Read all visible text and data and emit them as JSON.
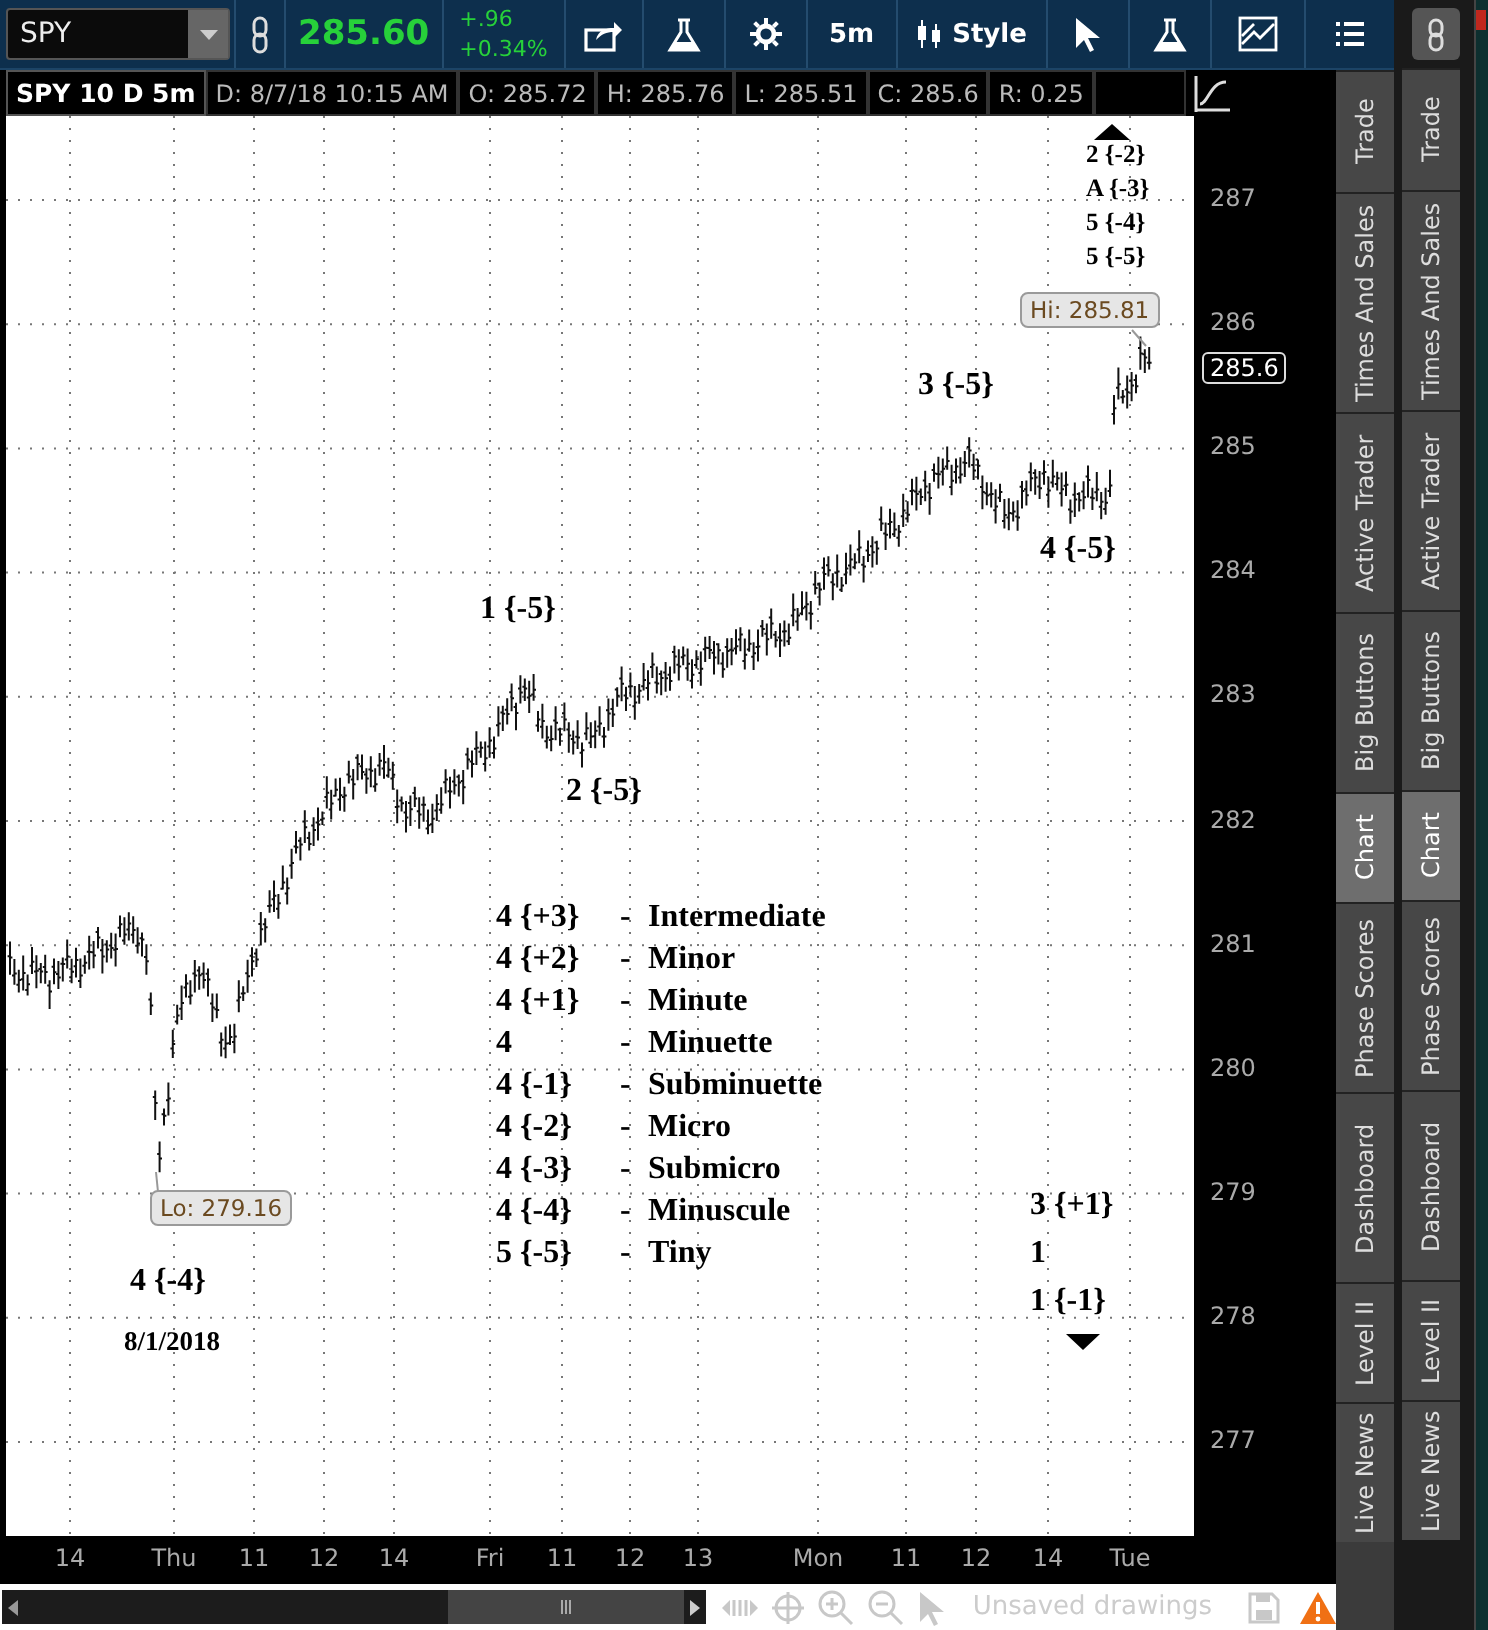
{
  "toolbar": {
    "symbol": "SPY",
    "last_price": "285.60",
    "change": "+.96",
    "change_percent": "+0.34%",
    "interval": "5m",
    "style_label": "Style"
  },
  "info_bar": {
    "title": "SPY 10 D 5m",
    "fields": [
      "D: 8/7/18 10:15 AM",
      "O: 285.72",
      "H: 285.76",
      "L: 285.51",
      "C: 285.6",
      "R: 0.25"
    ]
  },
  "chart": {
    "y_axis_labels": [
      "287",
      "286",
      "285",
      "284",
      "283",
      "282",
      "281",
      "280",
      "279",
      "278",
      "277"
    ],
    "last_price_label": "285.6",
    "x_axis_labels": [
      "14",
      "Thu",
      "11",
      "12",
      "14",
      "Fri",
      "11",
      "12",
      "13",
      "Mon",
      "11",
      "12",
      "14",
      "Tue"
    ],
    "annotations": [
      "1 {-5}",
      "2 {-5}",
      "3 {-5}",
      "4 {-5}",
      "2 {-2}",
      "A {-3}",
      "5 {-4}",
      "5 {-5}",
      "3 {+1}",
      "1",
      "1 {-1}",
      "4 {-4}",
      "8/1/2018"
    ],
    "legend": [
      {
        "wave": "4 {+3}",
        "separator": "-",
        "degree": "Intermediate"
      },
      {
        "wave": "4 {+2}",
        "separator": "-",
        "degree": "Minor"
      },
      {
        "wave": "4 {+1}",
        "separator": "-",
        "degree": "Minute"
      },
      {
        "wave": "4",
        "separator": "-",
        "degree": "Minuette"
      },
      {
        "wave": "4 {-1}",
        "separator": "-",
        "degree": "Subminuette"
      },
      {
        "wave": "4 {-2}",
        "separator": "-",
        "degree": "Micro"
      },
      {
        "wave": "4 {-3}",
        "separator": "-",
        "degree": "Submicro"
      },
      {
        "wave": "4 {-4}",
        "separator": "-",
        "degree": "Minuscule"
      },
      {
        "wave": "5 {-5}",
        "separator": "-",
        "degree": "Tiny"
      }
    ],
    "high_callout": "Hi: 285.81",
    "low_callout": "Lo: 279.16"
  },
  "drawing_bar": {
    "status": "Unsaved drawings"
  },
  "side_tabs": [
    {
      "label": "Trade",
      "selected": false
    },
    {
      "label": "Times And Sales",
      "selected": false
    },
    {
      "label": "Active Trader",
      "selected": false
    },
    {
      "label": "Big Buttons",
      "selected": false
    },
    {
      "label": "Chart",
      "selected": true
    },
    {
      "label": "Phase Scores",
      "selected": false
    },
    {
      "label": "Dashboard",
      "selected": false
    },
    {
      "label": "Level II",
      "selected": false
    },
    {
      "label": "Live News",
      "selected": false
    }
  ],
  "second_panel": {
    "tabs": [
      {
        "label": "Trade",
        "selected": false
      },
      {
        "label": "Times And Sales",
        "selected": false
      },
      {
        "label": "Active Trader",
        "selected": false
      },
      {
        "label": "Big Buttons",
        "selected": false
      },
      {
        "label": "Chart",
        "selected": true
      },
      {
        "label": "Phase Scores",
        "selected": false
      },
      {
        "label": "Dashboard",
        "selected": false
      },
      {
        "label": "Level II",
        "selected": false
      },
      {
        "label": "Live News",
        "selected": false
      }
    ]
  }
}
